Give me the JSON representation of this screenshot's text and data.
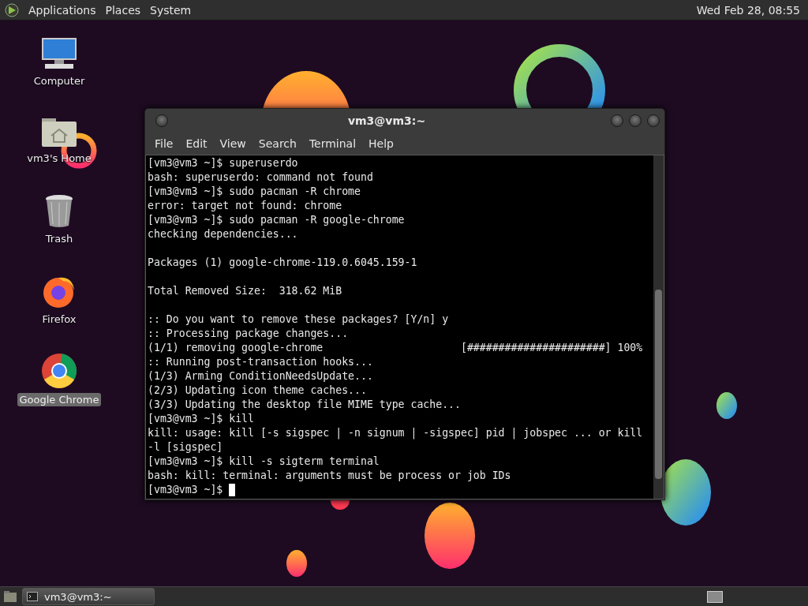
{
  "top_panel": {
    "menus": [
      "Applications",
      "Places",
      "System"
    ],
    "clock": "Wed Feb 28, 08:55"
  },
  "desktop_icons": [
    {
      "kind": "computer",
      "label": "Computer",
      "selected": false
    },
    {
      "kind": "home",
      "label": "vm3's Home",
      "selected": false
    },
    {
      "kind": "trash",
      "label": "Trash",
      "selected": false
    },
    {
      "kind": "firefox",
      "label": "Firefox",
      "selected": false
    },
    {
      "kind": "chrome",
      "label": "Google Chrome",
      "selected": true
    }
  ],
  "terminal": {
    "title": "vm3@vm3:~",
    "menu": [
      "File",
      "Edit",
      "View",
      "Search",
      "Terminal",
      "Help"
    ],
    "lines": [
      {
        "kind": "text",
        "text": "[vm3@vm3 ~]$ superuserdo"
      },
      {
        "kind": "text",
        "text": "bash: superuserdo: command not found"
      },
      {
        "kind": "text",
        "text": "[vm3@vm3 ~]$ sudo pacman -R chrome"
      },
      {
        "kind": "text",
        "text": "error: target not found: chrome"
      },
      {
        "kind": "text",
        "text": "[vm3@vm3 ~]$ sudo pacman -R google-chrome"
      },
      {
        "kind": "text",
        "text": "checking dependencies..."
      },
      {
        "kind": "blank"
      },
      {
        "kind": "text",
        "text": "Packages (1) google-chrome-119.0.6045.159-1"
      },
      {
        "kind": "blank"
      },
      {
        "kind": "text",
        "text": "Total Removed Size:  318.62 MiB"
      },
      {
        "kind": "blank"
      },
      {
        "kind": "text",
        "text": ":: Do you want to remove these packages? [Y/n] y"
      },
      {
        "kind": "text",
        "text": ":: Processing package changes..."
      },
      {
        "kind": "text",
        "text": "(1/1) removing google-chrome                      [######################] 100%"
      },
      {
        "kind": "text",
        "text": ":: Running post-transaction hooks..."
      },
      {
        "kind": "text",
        "text": "(1/3) Arming ConditionNeedsUpdate..."
      },
      {
        "kind": "text",
        "text": "(2/3) Updating icon theme caches..."
      },
      {
        "kind": "text",
        "text": "(3/3) Updating the desktop file MIME type cache..."
      },
      {
        "kind": "text",
        "text": "[vm3@vm3 ~]$ kill"
      },
      {
        "kind": "text",
        "text": "kill: usage: kill [-s sigspec | -n signum | -sigspec] pid | jobspec ... or kill"
      },
      {
        "kind": "text",
        "text": "-l [sigspec]"
      },
      {
        "kind": "text",
        "text": "[vm3@vm3 ~]$ kill -s sigterm terminal"
      },
      {
        "kind": "text",
        "text": "bash: kill: terminal: arguments must be process or job IDs"
      },
      {
        "kind": "cursor",
        "text": "[vm3@vm3 ~]$ "
      }
    ]
  },
  "taskbar": {
    "tasks": [
      {
        "label": "vm3@vm3:~",
        "selected": true
      }
    ]
  }
}
